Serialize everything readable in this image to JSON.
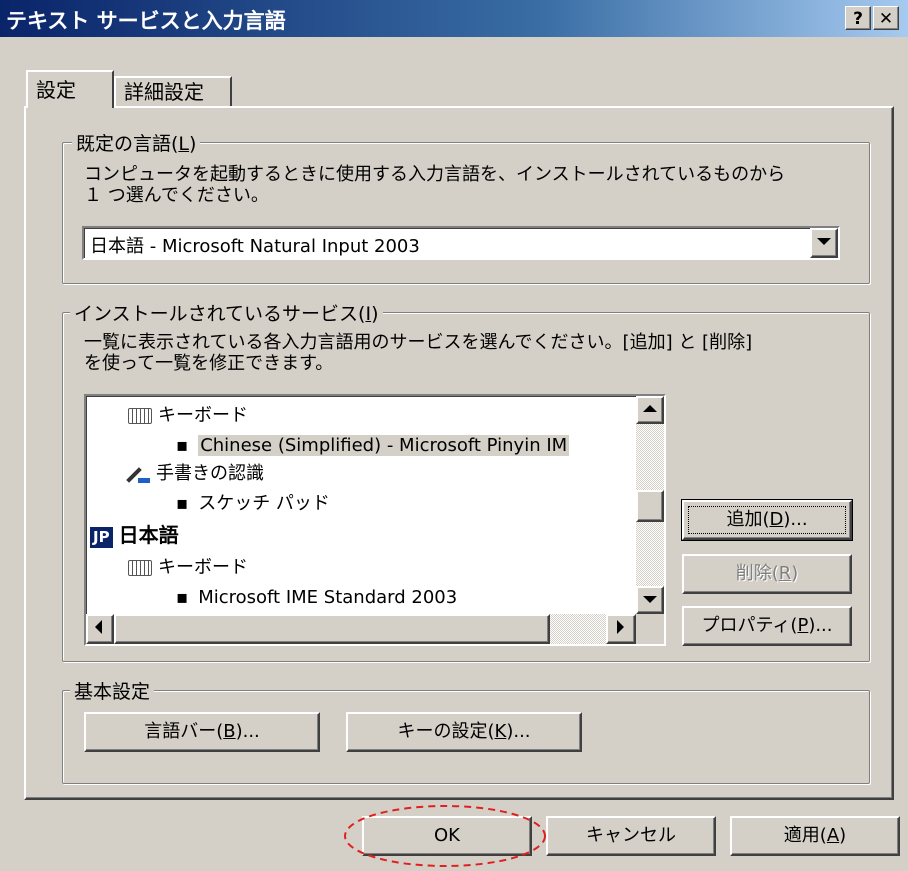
{
  "window": {
    "title": "テキスト サービスと入力言語",
    "help": "?",
    "close": "✕"
  },
  "tabs": [
    {
      "label": "設定",
      "active": true
    },
    {
      "label": "詳細設定",
      "active": false
    }
  ],
  "default_language": {
    "legend": "既定の言語(L)",
    "legend_pre": "既定の言語(",
    "legend_key": "L",
    "legend_post": ")",
    "description_line1": "コンピュータを起動するときに使用する入力言語を、インストールされているものから",
    "description_line2": "１ つ選んでください。",
    "selected": "日本語 - Microsoft Natural Input 2003"
  },
  "installed_services": {
    "legend_pre": "インストールされているサービス(",
    "legend_key": "I",
    "legend_post": ")",
    "description_line1": "一覧に表示されている各入力言語用のサービスを選んでください。[追加] と [削除]",
    "description_line2": "を使って一覧を修正できます。",
    "items": [
      {
        "kind": "category",
        "icon": "keyboard-icon",
        "label": "キーボード"
      },
      {
        "kind": "service",
        "label": "Chinese (Simplified) - Microsoft Pinyin IM",
        "selected": true
      },
      {
        "kind": "category",
        "icon": "handwriting-icon",
        "label": "手書きの認識"
      },
      {
        "kind": "service",
        "label": "スケッチ パッド"
      },
      {
        "kind": "language",
        "badge": "JP",
        "label": "日本語"
      },
      {
        "kind": "category",
        "icon": "keyboard-icon",
        "label": "キーボード"
      },
      {
        "kind": "service",
        "label": "Microsoft IME Standard 2003"
      }
    ],
    "buttons": {
      "add_pre": "追加(",
      "add_key": "D",
      "add_post": ")...",
      "remove_pre": "削除(",
      "remove_key": "R",
      "remove_post": ")",
      "properties_pre": "プロパティ(",
      "properties_key": "P",
      "properties_post": ")..."
    },
    "bullet": "▪"
  },
  "preferences": {
    "legend": "基本設定",
    "language_bar_pre": "言語バー(",
    "language_bar_key": "B",
    "language_bar_post": ")...",
    "key_settings_pre": "キーの設定(",
    "key_settings_key": "K",
    "key_settings_post": ")..."
  },
  "footer": {
    "ok": "OK",
    "cancel": "キャンセル",
    "apply_pre": "適用(",
    "apply_key": "A",
    "apply_post": ")"
  },
  "colors": {
    "annotation": "#e02020",
    "selection": "#d4d0c8",
    "title_start": "#0a246a"
  }
}
